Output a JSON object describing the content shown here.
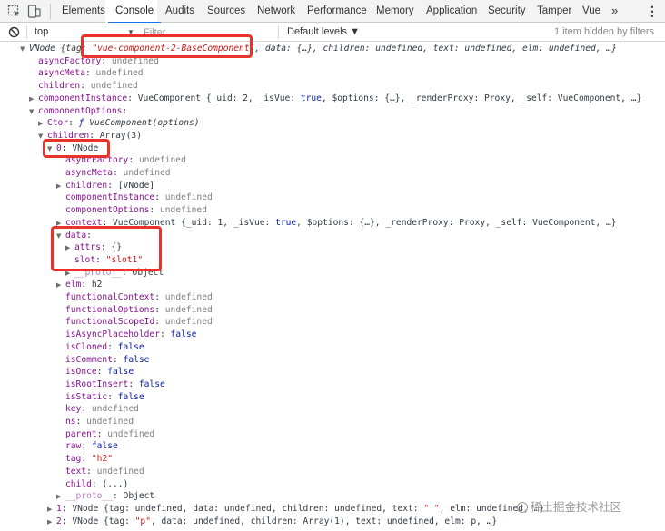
{
  "tabs": [
    "Elements",
    "Console",
    "Audits",
    "Sources",
    "Network",
    "Performance",
    "Memory",
    "Application",
    "Security",
    "Tamper",
    "Vue"
  ],
  "active_tab": "Console",
  "overflow_label": "»",
  "kebab_label": "⋮",
  "toolbar": {
    "context": "top",
    "context_arrow": "▼",
    "filter_placeholder": "Filter",
    "levels": "Default levels ▼",
    "hidden_info": "1 item hidden by filters"
  },
  "tree": [
    {
      "indent": 0,
      "tri": "▼",
      "parts": [
        {
          "t": "VNode {tag: ",
          "c": "it"
        },
        {
          "t": "\"vue-component-2-BaseComponent\"",
          "c": "v-str it"
        },
        {
          "t": ", data: {…}, children: undefined, text: undefined, elm: undefined, …}",
          "c": "it"
        }
      ]
    },
    {
      "indent": 1,
      "tri": "",
      "key": "asyncFactory",
      "val": "undefined",
      "vc": "v-un"
    },
    {
      "indent": 1,
      "tri": "",
      "key": "asyncMeta",
      "val": "undefined",
      "vc": "v-un"
    },
    {
      "indent": 1,
      "tri": "",
      "key": "children",
      "val": "undefined",
      "vc": "v-un"
    },
    {
      "indent": 1,
      "tri": "▶",
      "key": "componentInstance",
      "parts": [
        {
          "t": "VueComponent {_uid: 2, _isVue: ",
          "c": "v-obj"
        },
        {
          "t": "true",
          "c": "v-kw"
        },
        {
          "t": ", $options: {…}, _renderProxy: Proxy, _self: VueComponent, …}",
          "c": "v-obj"
        }
      ]
    },
    {
      "indent": 1,
      "tri": "▼",
      "key": "componentOptions",
      "val": "",
      "vc": ""
    },
    {
      "indent": 2,
      "tri": "▶",
      "key": "Ctor",
      "parts": [
        {
          "t": "ƒ ",
          "c": "v-kw it"
        },
        {
          "t": "VueComponent(options)",
          "c": "it"
        }
      ]
    },
    {
      "indent": 2,
      "tri": "▼",
      "key": "children",
      "val": "Array(3)",
      "vc": "v-obj"
    },
    {
      "indent": 3,
      "tri": "▼",
      "key": "0",
      "val": "VNode",
      "vc": "v-obj"
    },
    {
      "indent": 4,
      "tri": "",
      "key": "asyncFactory",
      "val": "undefined",
      "vc": "v-un"
    },
    {
      "indent": 4,
      "tri": "",
      "key": "asyncMeta",
      "val": "undefined",
      "vc": "v-un"
    },
    {
      "indent": 4,
      "tri": "▶",
      "key": "children",
      "val": "[VNode]",
      "vc": "v-obj"
    },
    {
      "indent": 4,
      "tri": "",
      "key": "componentInstance",
      "val": "undefined",
      "vc": "v-un"
    },
    {
      "indent": 4,
      "tri": "",
      "key": "componentOptions",
      "val": "undefined",
      "vc": "v-un"
    },
    {
      "indent": 4,
      "tri": "▶",
      "key": "context",
      "parts": [
        {
          "t": "VueComponent {_uid: 1, _isVue: ",
          "c": "v-obj"
        },
        {
          "t": "true",
          "c": "v-kw"
        },
        {
          "t": ", $options: {…}, _renderProxy: Proxy, _self: VueComponent, …}",
          "c": "v-obj"
        }
      ]
    },
    {
      "indent": 4,
      "tri": "▼",
      "key": "data",
      "val": "",
      "vc": ""
    },
    {
      "indent": 5,
      "tri": "▶",
      "key": "attrs",
      "val": "{}",
      "vc": "v-obj"
    },
    {
      "indent": 5,
      "tri": "",
      "key": "slot",
      "val": "\"slot1\"",
      "vc": "v-str"
    },
    {
      "indent": 5,
      "tri": "▶",
      "key": "__proto__",
      "val": "Object",
      "vc": "v-obj",
      "kc": "k-dim"
    },
    {
      "indent": 4,
      "tri": "▶",
      "key": "elm",
      "val": "h2",
      "vc": "v-obj"
    },
    {
      "indent": 4,
      "tri": "",
      "key": "functionalContext",
      "val": "undefined",
      "vc": "v-un"
    },
    {
      "indent": 4,
      "tri": "",
      "key": "functionalOptions",
      "val": "undefined",
      "vc": "v-un"
    },
    {
      "indent": 4,
      "tri": "",
      "key": "functionalScopeId",
      "val": "undefined",
      "vc": "v-un"
    },
    {
      "indent": 4,
      "tri": "",
      "key": "isAsyncPlaceholder",
      "val": "false",
      "vc": "v-kw"
    },
    {
      "indent": 4,
      "tri": "",
      "key": "isCloned",
      "val": "false",
      "vc": "v-kw"
    },
    {
      "indent": 4,
      "tri": "",
      "key": "isComment",
      "val": "false",
      "vc": "v-kw"
    },
    {
      "indent": 4,
      "tri": "",
      "key": "isOnce",
      "val": "false",
      "vc": "v-kw"
    },
    {
      "indent": 4,
      "tri": "",
      "key": "isRootInsert",
      "val": "false",
      "vc": "v-kw"
    },
    {
      "indent": 4,
      "tri": "",
      "key": "isStatic",
      "val": "false",
      "vc": "v-kw"
    },
    {
      "indent": 4,
      "tri": "",
      "key": "key",
      "val": "undefined",
      "vc": "v-un"
    },
    {
      "indent": 4,
      "tri": "",
      "key": "ns",
      "val": "undefined",
      "vc": "v-un"
    },
    {
      "indent": 4,
      "tri": "",
      "key": "parent",
      "val": "undefined",
      "vc": "v-un"
    },
    {
      "indent": 4,
      "tri": "",
      "key": "raw",
      "val": "false",
      "vc": "v-kw"
    },
    {
      "indent": 4,
      "tri": "",
      "key": "tag",
      "val": "\"h2\"",
      "vc": "v-str"
    },
    {
      "indent": 4,
      "tri": "",
      "key": "text",
      "val": "undefined",
      "vc": "v-un"
    },
    {
      "indent": 4,
      "tri": "",
      "key": "child",
      "val": "(...)",
      "vc": "v-obj"
    },
    {
      "indent": 4,
      "tri": "▶",
      "key": "__proto__",
      "val": "Object",
      "vc": "v-obj",
      "kc": "k-dim"
    },
    {
      "indent": 3,
      "tri": "▶",
      "key": "1",
      "parts": [
        {
          "t": "VNode {tag: undefined, data: undefined, children: undefined, text: ",
          "c": "v-obj"
        },
        {
          "t": "\" \"",
          "c": "v-str"
        },
        {
          "t": ", elm: undefined, …}",
          "c": "v-obj"
        }
      ]
    },
    {
      "indent": 3,
      "tri": "▶",
      "key": "2",
      "parts": [
        {
          "t": "VNode {tag: ",
          "c": "v-obj"
        },
        {
          "t": "\"p\"",
          "c": "v-str"
        },
        {
          "t": ", data: undefined, children: Array(1), text: undefined, elm: p, …}",
          "c": "v-obj"
        }
      ]
    }
  ],
  "watermark": "稀土掘金技术社区"
}
